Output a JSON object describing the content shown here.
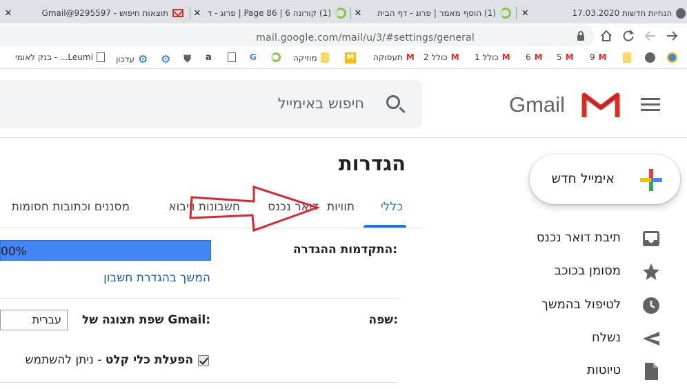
{
  "browser": {
    "tabs": [
      {
        "title": "הנחיות חדשות 17.03.2020",
        "close": "✕"
      },
      {
        "title": "(1) הוסף מאמר | פרוג - דף הבית",
        "close": "✕"
      },
      {
        "title": "(1) קורונה 6 | Page 86 | פרוג - דף",
        "close": "✕"
      },
      {
        "title": "תוצאות חיפוש - Gmail@9295597",
        "close": "✕"
      }
    ],
    "url": "mail.google.com/mail/u/3/#settings/general",
    "bookmarks": [
      {
        "label": "9"
      },
      {
        "label": "5"
      },
      {
        "label": "6"
      },
      {
        "label": "כולל 1"
      },
      {
        "label": "כולל 2"
      },
      {
        "label": "תעסוקה"
      },
      {
        "label": "מוזיקה"
      },
      {
        "label": "עדכון"
      },
      {
        "label": "בנק לאומי - ...Leumi"
      }
    ]
  },
  "gmail": {
    "brand": "Gmail",
    "search": {
      "placeholder": "חיפוש באימייל"
    },
    "compose_label": "אימייל חדש",
    "nav": [
      {
        "label": "תיבת דואר נכנס",
        "icon": "inbox-icon"
      },
      {
        "label": "מסומן בכוכב",
        "icon": "star-icon"
      },
      {
        "label": "לטיפול בהמשך",
        "icon": "clock-icon"
      },
      {
        "label": "נשלח",
        "icon": "send-icon"
      },
      {
        "label": "טיוטות",
        "icon": "draft-icon"
      }
    ]
  },
  "settings": {
    "title": "הגדרות",
    "tabs": [
      "כללי",
      "תוויות",
      "דואר נכנס",
      "חשבונות וייבוא",
      "מסננים וכתובות חסומות"
    ],
    "progress_label": "התקדמות ההגדרה:",
    "progress_value": "00%",
    "progress_fraction": 1.0,
    "continue_link": "המשך בהגדרת חשבון",
    "language_label": "שפה:",
    "display_language_label": "שפת תצוגה של Gmail:",
    "display_language_value": "עברית",
    "click_label_bold": "הפעלת כלי קלט",
    "click_label_rest": " - ניתן להשתמש",
    "annotation_color": "#e0242c",
    "accent_color": "#1a73e8"
  }
}
